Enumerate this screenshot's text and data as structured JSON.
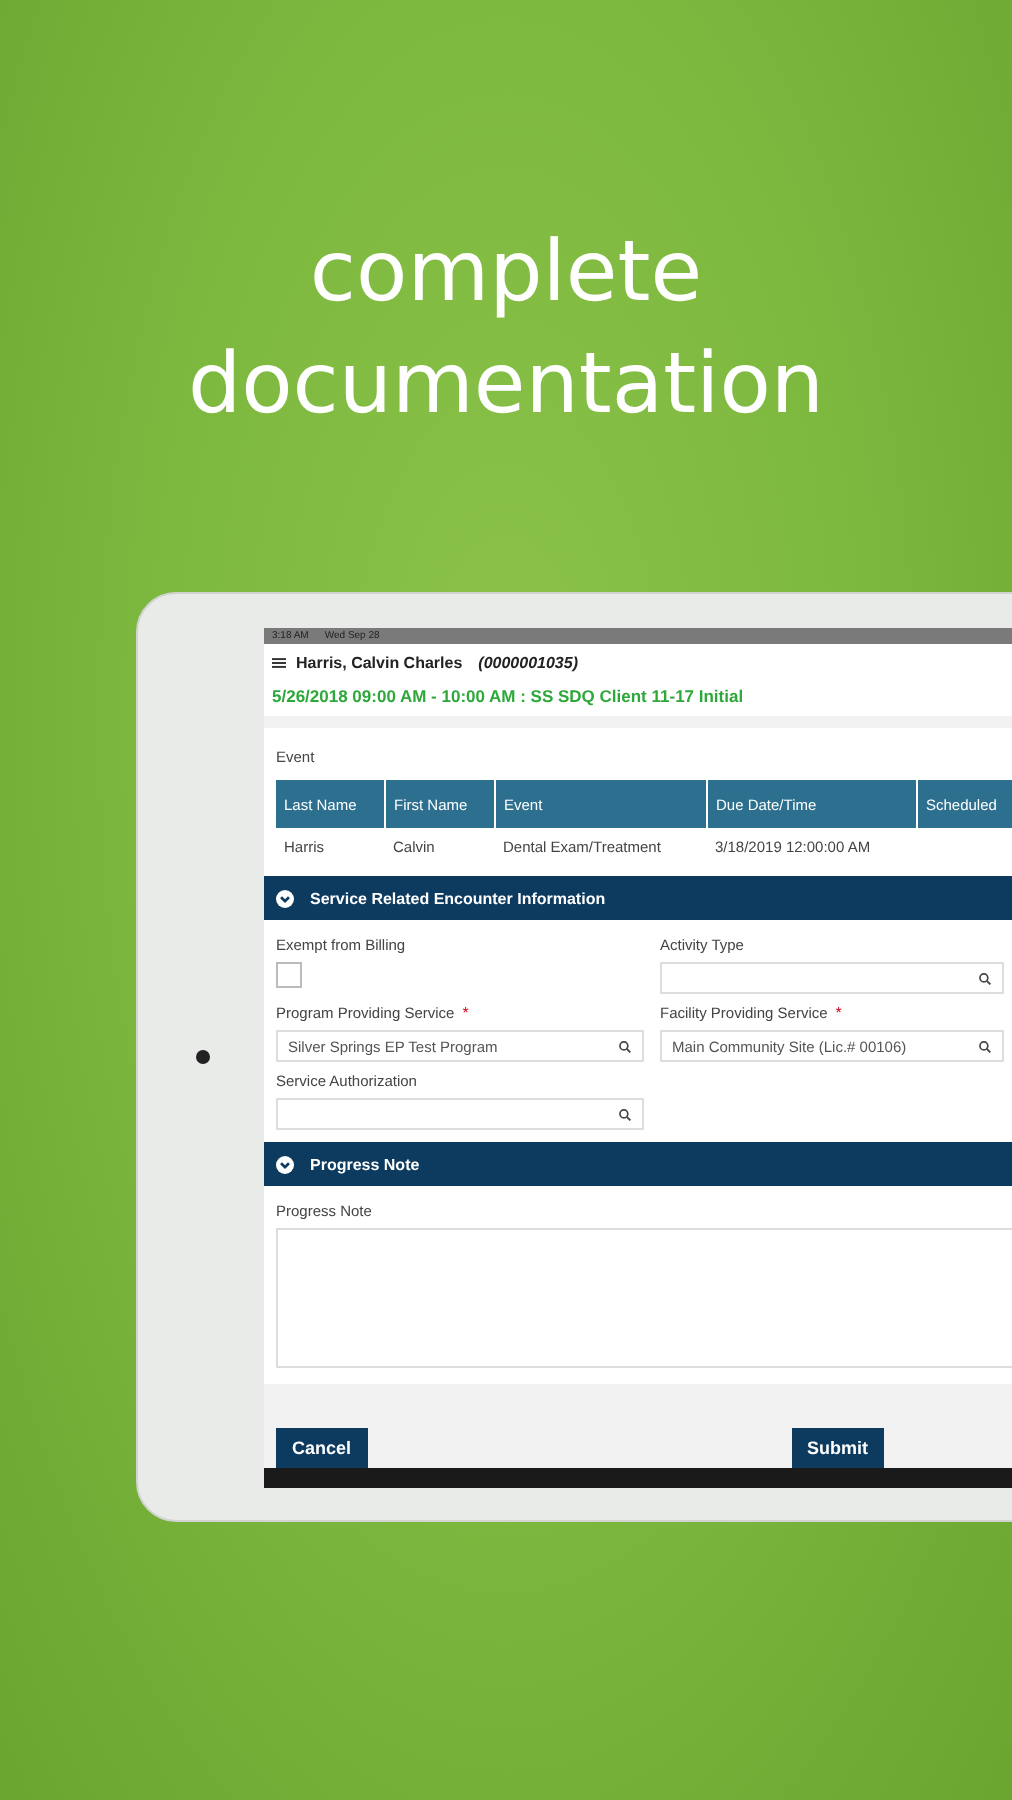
{
  "headline": "complete documentation",
  "status_bar": {
    "time": "3:18 AM",
    "date": "Wed Sep 28"
  },
  "header": {
    "patient_name": "Harris, Calvin Charles",
    "patient_id": "(0000001035)",
    "appointment": "5/26/2018 09:00 AM - 10:00 AM : SS SDQ Client 11-17 Initial"
  },
  "event": {
    "label": "Event",
    "table": {
      "columns": [
        "Last Name",
        "First Name",
        "Event",
        "Due Date/Time",
        "Scheduled"
      ],
      "rows": [
        [
          "Harris",
          "Calvin",
          "Dental Exam/Treatment",
          "3/18/2019 12:00:00 AM"
        ]
      ]
    }
  },
  "sections": [
    {
      "title": "Service Related Encounter Information",
      "expanded": true,
      "fields": [
        {
          "kind": "checkbox",
          "label": "Exempt from Billing",
          "checked": false
        },
        {
          "kind": "lookup",
          "label": "Activity Type"
        },
        {
          "kind": "lookup",
          "label": "Program Providing Service",
          "required_mark": "*",
          "value": "Silver Springs EP Test Program"
        },
        {
          "kind": "lookup",
          "label": "Facility Providing Service",
          "required_mark": "*",
          "value": "Main Community Site (Lic.# 00106)"
        },
        {
          "kind": "lookup",
          "label": "Service Authorization"
        }
      ]
    },
    {
      "title": "Progress Note",
      "expanded": true,
      "fields": [
        {
          "kind": "textarea",
          "label": "Progress Note"
        }
      ]
    }
  ],
  "buttons": [
    {
      "label": "Cancel"
    },
    {
      "label": "Submit"
    }
  ]
}
